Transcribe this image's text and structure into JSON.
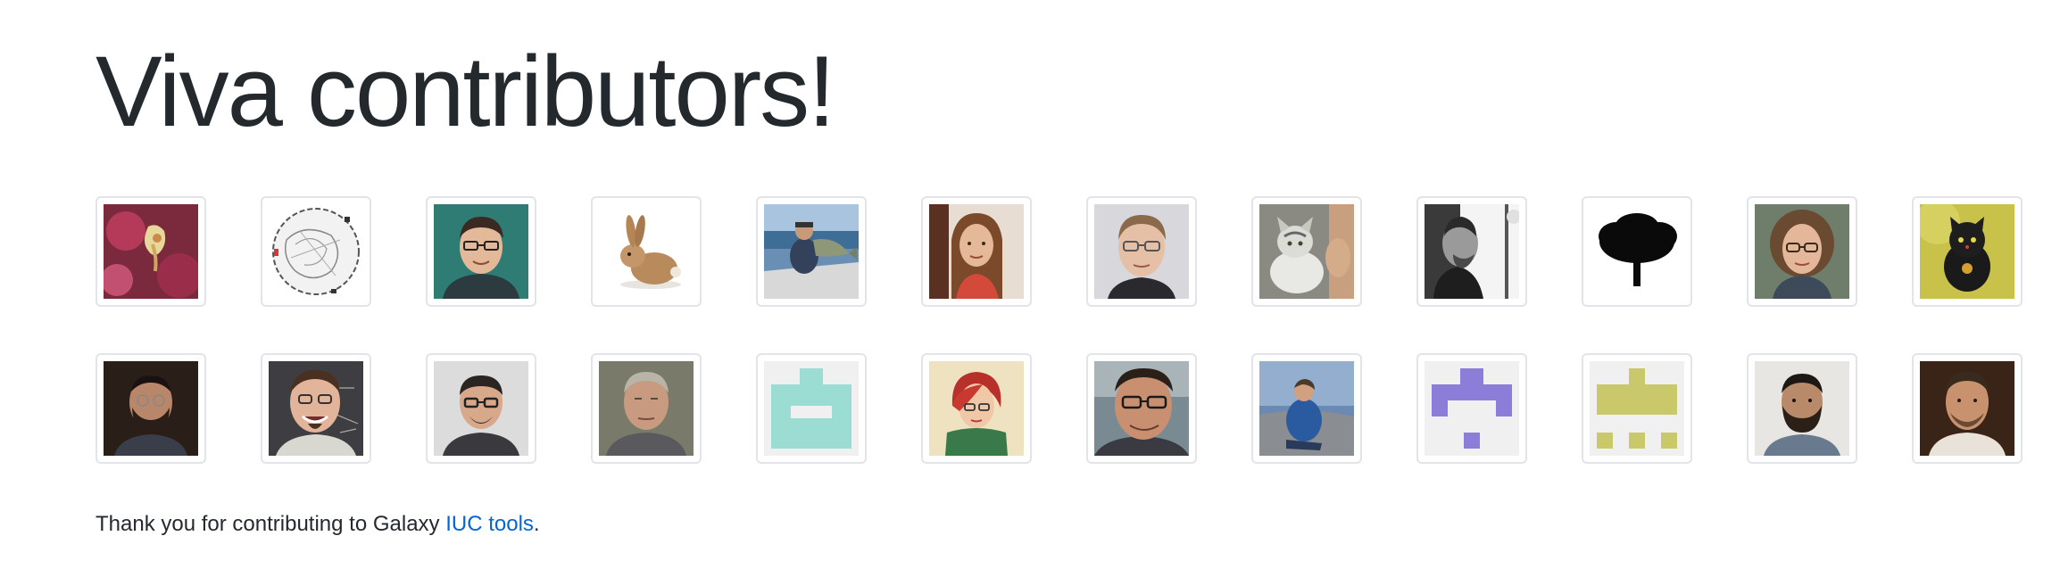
{
  "heading": "Viva contributors!",
  "avatars": {
    "row1": [
      {
        "name": "avatar-orchid-flower"
      },
      {
        "name": "avatar-sketch-circle"
      },
      {
        "name": "avatar-man-glasses-teal"
      },
      {
        "name": "avatar-rabbit"
      },
      {
        "name": "avatar-man-boat-fish"
      },
      {
        "name": "avatar-woman-long-hair"
      },
      {
        "name": "avatar-man-glasses-blond"
      },
      {
        "name": "avatar-cat"
      },
      {
        "name": "avatar-man-bw-profile"
      },
      {
        "name": "avatar-tree-silhouette"
      },
      {
        "name": "avatar-woman-curly-glasses"
      },
      {
        "name": "avatar-black-cat-figurine"
      }
    ],
    "row2": [
      {
        "name": "avatar-man-beard-glasses-dark"
      },
      {
        "name": "avatar-man-goatee-blackboard"
      },
      {
        "name": "avatar-man-glasses-bald"
      },
      {
        "name": "avatar-older-man-grey"
      },
      {
        "name": "avatar-identicon-teal"
      },
      {
        "name": "avatar-redhead-illustration"
      },
      {
        "name": "avatar-man-selfie-glasses"
      },
      {
        "name": "avatar-man-blue-jacket"
      },
      {
        "name": "avatar-identicon-purple"
      },
      {
        "name": "avatar-identicon-olive"
      },
      {
        "name": "avatar-man-beard-young"
      },
      {
        "name": "avatar-man-dark-portrait"
      }
    ]
  },
  "footer": {
    "prefix": "Thank you for contributing to Galaxy ",
    "link_text": "IUC tools",
    "suffix": "."
  },
  "colors": {
    "text": "#24292e",
    "link": "#0366d6",
    "border": "#e1e4e8",
    "identicon_teal": "#9bdcd3",
    "identicon_purple": "#8c7ed8",
    "identicon_olive": "#c9c86a"
  }
}
